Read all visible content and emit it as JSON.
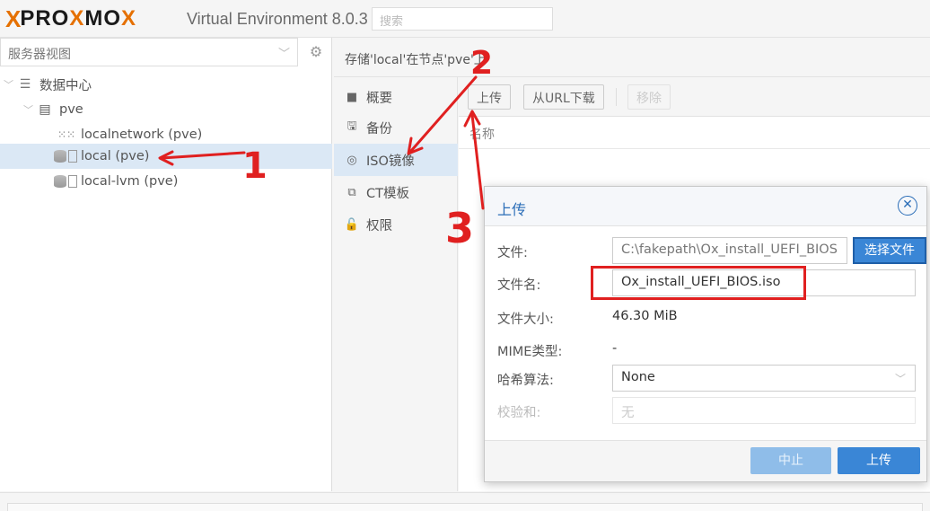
{
  "topbar": {
    "logo_x": "X",
    "logo_word_a": "PRO",
    "logo_word_b": "X",
    "logo_word_c": "MO",
    "logo_word_d": "X",
    "version": "Virtual Environment 8.0.3",
    "search_placeholder": "搜索"
  },
  "left": {
    "view_selector": "服务器视图",
    "tree": [
      {
        "label": "数据中心",
        "icon": "datacenter-icon"
      },
      {
        "label": "pve",
        "icon": "node-icon"
      },
      {
        "label": "localnetwork (pve)",
        "icon": "network-grid-icon"
      },
      {
        "label": "local (pve)",
        "icon": "storage-icon"
      },
      {
        "label": "local-lvm (pve)",
        "icon": "storage-icon"
      }
    ]
  },
  "right": {
    "header": "存储'local'在节点'pve'上",
    "subnav": [
      {
        "label": "概要",
        "icon": "book-icon"
      },
      {
        "label": "备份",
        "icon": "floppy-icon"
      },
      {
        "label": "ISO镜像",
        "icon": "disc-icon"
      },
      {
        "label": "CT模板",
        "icon": "template-icon"
      },
      {
        "label": "权限",
        "icon": "unlock-icon"
      }
    ],
    "toolbar": {
      "upload": "上传",
      "download_url": "从URL下载",
      "remove": "移除"
    },
    "column_name": "名称"
  },
  "dialog": {
    "title": "上传",
    "fields": {
      "file_label": "文件:",
      "file_value": "C:\\fakepath\\Ox_install_UEFI_BIOS",
      "choose_file": "选择文件",
      "filename_label": "文件名:",
      "filename_value": "Ox_install_UEFI_BIOS.iso",
      "filesize_label": "文件大小:",
      "filesize_value": "46.30 MiB",
      "mime_label": "MIME类型:",
      "mime_value": "-",
      "hash_label": "哈希算法:",
      "hash_value": "None",
      "checksum_label": "校验和:",
      "checksum_placeholder": "无"
    },
    "abort": "中止",
    "upload": "上传"
  },
  "annotations": {
    "step1": "1",
    "step2": "2",
    "step3": "3",
    "color": "#e02020"
  },
  "colors": {
    "accent": "#3a86d6",
    "logo_orange": "#e57000",
    "selected_bg": "#dbe8f5"
  }
}
